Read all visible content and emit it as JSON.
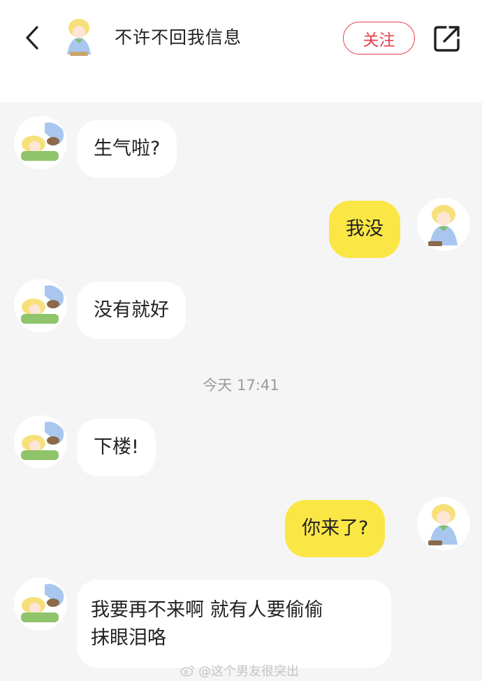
{
  "header": {
    "title": "不许不回我信息",
    "follow_label": "关注"
  },
  "icons": {
    "back": "chevron-left-icon",
    "share": "share-external-icon",
    "weibo": "weibo-icon"
  },
  "colors": {
    "accent": "#e5414b",
    "outgoing_bubble": "#fae645",
    "incoming_bubble": "#ffffff",
    "background": "#f5f5f5"
  },
  "messages": [
    {
      "side": "in",
      "text": "生气啦?"
    },
    {
      "side": "out",
      "text": "我没"
    },
    {
      "side": "in",
      "text": "没有就好"
    },
    {
      "side": "in",
      "text": "下楼!"
    },
    {
      "side": "out",
      "text": "你来了?"
    },
    {
      "side": "in",
      "line1": "我要再不来啊 就有人要偷偷",
      "line2": "抹眼泪咯"
    }
  ],
  "timestamp": "今天 17:41",
  "watermark": "@这个男友很突出"
}
